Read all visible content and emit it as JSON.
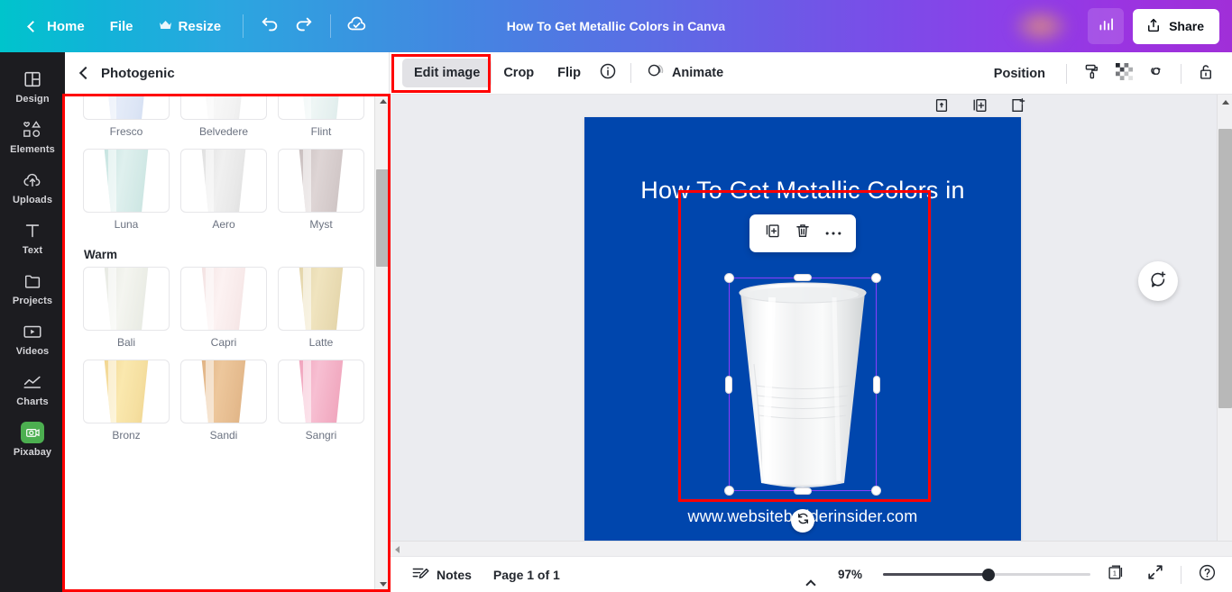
{
  "header": {
    "back_icon": "chevron-left-icon",
    "home_label": "Home",
    "file_label": "File",
    "resize_label": "Resize",
    "resize_icon": "crown-icon",
    "undo_icon": "undo-icon",
    "redo_icon": "redo-icon",
    "cloud_icon": "cloud-saved-icon",
    "title": "How To Get Metallic Colors in Canva",
    "stats_icon": "bar-chart-icon",
    "share_icon": "share-upload-icon",
    "share_label": "Share",
    "gradient_start": "#00c4cc",
    "gradient_end": "#a02fd8"
  },
  "sidebar": {
    "items": [
      {
        "label": "Design",
        "icon": "layout-icon"
      },
      {
        "label": "Elements",
        "icon": "shapes-icon"
      },
      {
        "label": "Uploads",
        "icon": "upload-cloud-icon"
      },
      {
        "label": "Text",
        "icon": "text-t-icon"
      },
      {
        "label": "Projects",
        "icon": "folder-icon"
      },
      {
        "label": "Videos",
        "icon": "video-play-icon"
      },
      {
        "label": "Charts",
        "icon": "line-chart-icon"
      },
      {
        "label": "Pixabay",
        "icon": "pixabay-camera-icon"
      }
    ],
    "background": "#1c1c20",
    "pixabay_color": "#4caf50"
  },
  "panel": {
    "back_icon": "chevron-left-icon",
    "title": "Photogenic",
    "sections": [
      {
        "name": "",
        "filters": [
          {
            "name": "Fresco",
            "tint": "#d9e2f3"
          },
          {
            "name": "Belvedere",
            "tint": "#f2f2f2"
          },
          {
            "name": "Flint",
            "tint": "#e3eeee"
          },
          {
            "name": "Luna",
            "tint": "#d5ebe9"
          },
          {
            "name": "Aero",
            "tint": "#e9e9e9"
          },
          {
            "name": "Myst",
            "tint": "#d9d2d2"
          }
        ]
      },
      {
        "name": "Warm",
        "filters": [
          {
            "name": "Bali",
            "tint": "#eeefea"
          },
          {
            "name": "Capri",
            "tint": "#f9eaea"
          },
          {
            "name": "Latte",
            "tint": "#ece0bb"
          },
          {
            "name": "Bronz",
            "tint": "#f5dfa4"
          },
          {
            "name": "Sandi",
            "tint": "#e8bd92"
          },
          {
            "name": "Sangri",
            "tint": "#f3afc4"
          }
        ]
      }
    ]
  },
  "context_toolbar": {
    "edit_image_label": "Edit image",
    "crop_label": "Crop",
    "flip_label": "Flip",
    "info_icon": "info-circle-icon",
    "animate_icon": "animate-circles-icon",
    "animate_label": "Animate",
    "position_label": "Position",
    "paint_icon": "paint-roller-icon",
    "transparency_icon": "transparency-checker-icon",
    "link_icon": "link-icon",
    "lock_icon": "lock-icon"
  },
  "canvas": {
    "page_tools": [
      {
        "icon": "lock-page-icon"
      },
      {
        "icon": "duplicate-page-icon"
      },
      {
        "icon": "add-page-icon"
      }
    ],
    "background_color": "#0046ad",
    "title_text": "How To Get Metallic Colors in",
    "url_text": "www.websitebuilderinsider.com",
    "element_toolbar": [
      {
        "icon": "duplicate-icon"
      },
      {
        "icon": "trash-icon"
      },
      {
        "icon": "more-dots-icon"
      }
    ],
    "selection_color": "#8b3dff",
    "rotate_icon": "rotate-icon",
    "comment_icon": "comment-plus-icon",
    "selected_element": "plastic-cup-image"
  },
  "bottom_bar": {
    "notes_icon": "notes-pencil-icon",
    "notes_label": "Notes",
    "page_indicator": "Page 1 of 1",
    "zoom_percent": "97%",
    "page_count_number": "1",
    "grid_icon": "page-grid-icon",
    "fullscreen_icon": "fullscreen-icon",
    "help_icon": "help-circle-icon"
  },
  "annotations": {
    "color": "#ff0000",
    "boxes": [
      "filter-panel",
      "edit-image-button",
      "selected-image"
    ]
  }
}
